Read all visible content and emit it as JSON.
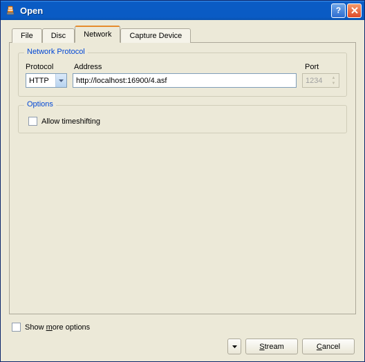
{
  "window": {
    "title": "Open"
  },
  "tabs": {
    "file": "File",
    "disc": "Disc",
    "network": "Network",
    "capture": "Capture Device"
  },
  "network_protocol": {
    "legend": "Network Protocol",
    "protocol_label": "Protocol",
    "address_label": "Address",
    "port_label": "Port",
    "protocol_value": "HTTP",
    "address_value": "http://localhost:16900/4.asf",
    "port_value": "1234"
  },
  "options": {
    "legend": "Options",
    "allow_timeshifting": "Allow timeshifting"
  },
  "footer": {
    "show_more_prefix": "Show ",
    "show_more_ul": "m",
    "show_more_suffix": "ore options",
    "stream_prefix": "",
    "stream_ul": "S",
    "stream_suffix": "tream",
    "cancel_prefix": "",
    "cancel_ul": "C",
    "cancel_suffix": "ancel"
  }
}
